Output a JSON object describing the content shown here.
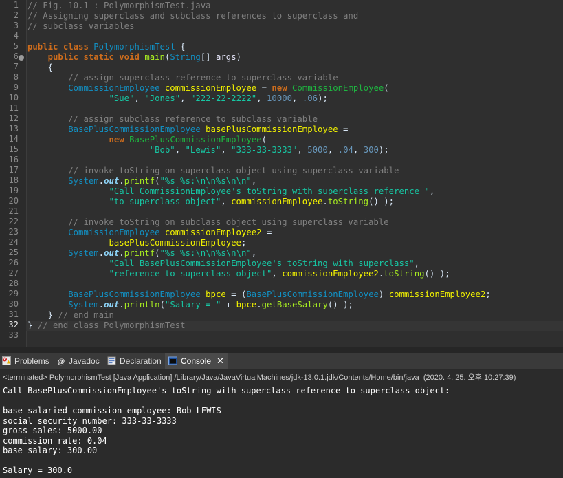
{
  "editor": {
    "line_numbers": [
      "1",
      "2",
      "3",
      "4",
      "5",
      "6",
      "7",
      "8",
      "9",
      "10",
      "11",
      "12",
      "13",
      "14",
      "15",
      "16",
      "17",
      "18",
      "19",
      "20",
      "21",
      "22",
      "23",
      "24",
      "25",
      "26",
      "27",
      "28",
      "29",
      "30",
      "31",
      "32",
      "33"
    ],
    "l1": "// Fig. 10.1 : PolymorphismTest.java",
    "l2": "// Assigning superclass and subclass references to superclass and",
    "l3": "// subclass variables",
    "l5": {
      "k1": "public",
      "k2": "class",
      "name": "PolymorphismTest",
      "brace": " {"
    },
    "l6": {
      "k1": "public",
      "k2": "static",
      "k3": "void",
      "m": "main",
      "p1": "(",
      "t": "String",
      "p2": "[] ",
      "a": "args",
      "p3": ")"
    },
    "l7": "{",
    "l8": "// assign superclass reference to superclass variable",
    "l9": {
      "t": "CommissionEmployee",
      "v": "commissionEmployee",
      "eq": " = ",
      "k": "new",
      "c": "CommissionEmployee",
      "p": "("
    },
    "l10": {
      "s1": "\"Sue\"",
      "c1": ", ",
      "s2": "\"Jones\"",
      "c2": ", ",
      "s3": "\"222-22-2222\"",
      "c3": ", ",
      "n1": "10000",
      "c4": ", ",
      "n2": ".06",
      "end": ");"
    },
    "l12": "// assign subclass reference to subclass variable",
    "l13": {
      "t": "BasePlusCommissionEmployee",
      "v": "basePlusCommissionEmployee",
      "eq": " ="
    },
    "l14": {
      "k": "new",
      "c": "BasePlusCommissionEmployee",
      "p": "("
    },
    "l15": {
      "s1": "\"Bob\"",
      "c1": ", ",
      "s2": "\"Lewis\"",
      "c2": ", ",
      "s3": "\"333-33-3333\"",
      "c3": ", ",
      "n1": "5000",
      "c4": ", ",
      "n2": ".04",
      "c5": ", ",
      "n3": "300",
      "end": ");"
    },
    "l17": "// invoke toString on superclass object using superclass variable",
    "l18": {
      "sys": "System",
      "dot": ".",
      "out": "out",
      "dot2": ".",
      "m": "printf",
      "p": "(",
      "s": "\"%s %s:\\n\\n%s\\n\\n\"",
      "end": ","
    },
    "l19": {
      "s": "\"Call CommissionEmployee's toString with superclass reference \"",
      "end": ","
    },
    "l20": {
      "s": "\"to superclass object\"",
      "c": ", ",
      "v": "commissionEmployee",
      "dot": ".",
      "m": "toString",
      "end": "() );"
    },
    "l22": "// invoke toString on subclass object using superclass variable",
    "l23": {
      "t": "CommissionEmployee",
      "v": "commissionEmployee2",
      "eq": " ="
    },
    "l24": {
      "v": "basePlusCommissionEmployee",
      "end": ";"
    },
    "l25": {
      "sys": "System",
      "dot": ".",
      "out": "out",
      "dot2": ".",
      "m": "printf",
      "p": "(",
      "s": "\"%s %s:\\n\\n%s\\n\\n\"",
      "end": ","
    },
    "l26": {
      "s": "\"Call BasePlusCommissionEmployee's toString with superclass\"",
      "end": ","
    },
    "l27": {
      "s": "\"reference to superclass object\"",
      "c": ", ",
      "v": "commissionEmployee2",
      "dot": ".",
      "m": "toString",
      "end": "() );"
    },
    "l29": {
      "t": "BasePlusCommissionEmployee",
      "v": "bpce",
      "eq": " = (",
      "t2": "BasePlusCommissionEmployee",
      "cp": ") ",
      "v2": "commissionEmployee2",
      "end": ";"
    },
    "l30": {
      "sys": "System",
      "dot": ".",
      "out": "out",
      "dot2": ".",
      "m": "println",
      "p": "(",
      "s": "\"Salary = \"",
      "plus": " + ",
      "v": "bpce",
      "dot3": ".",
      "m2": "getBaseSalary",
      "end": "() );"
    },
    "l31": {
      "b": "} ",
      "cm": "// end main"
    },
    "l32": {
      "b": "} ",
      "cm": "// end class PolymorphismTest"
    }
  },
  "tabs": {
    "problems": "Problems",
    "javadoc": "Javadoc",
    "declaration": "Declaration",
    "console": "Console",
    "close": "✕"
  },
  "console": {
    "status": "<terminated> PolymorphismTest [Java Application] /Library/Java/JavaVirtualMachines/jdk-13.0.1.jdk/Contents/Home/bin/java  (2020. 4. 25. 오후 10:27:39)",
    "lines": [
      "Call BasePlusCommissionEmployee's toString with superclass reference to superclass object:",
      "",
      "base-salaried commission employee: Bob LEWIS",
      "social security number: 333-33-3333",
      "gross sales: 5000.00",
      "commission rate: 0.04",
      "base salary: 300.00",
      "",
      "Salary = 300.0"
    ]
  },
  "colors": {
    "keyword": "#cc6c1d",
    "comment": "#808080",
    "type": "#1290c3",
    "class_name": "#1eb540",
    "variable": "#f2f200",
    "string": "#17c6a3",
    "number": "#6897bb",
    "static_field": "#8dd3f7",
    "method": "#a7ec21"
  }
}
